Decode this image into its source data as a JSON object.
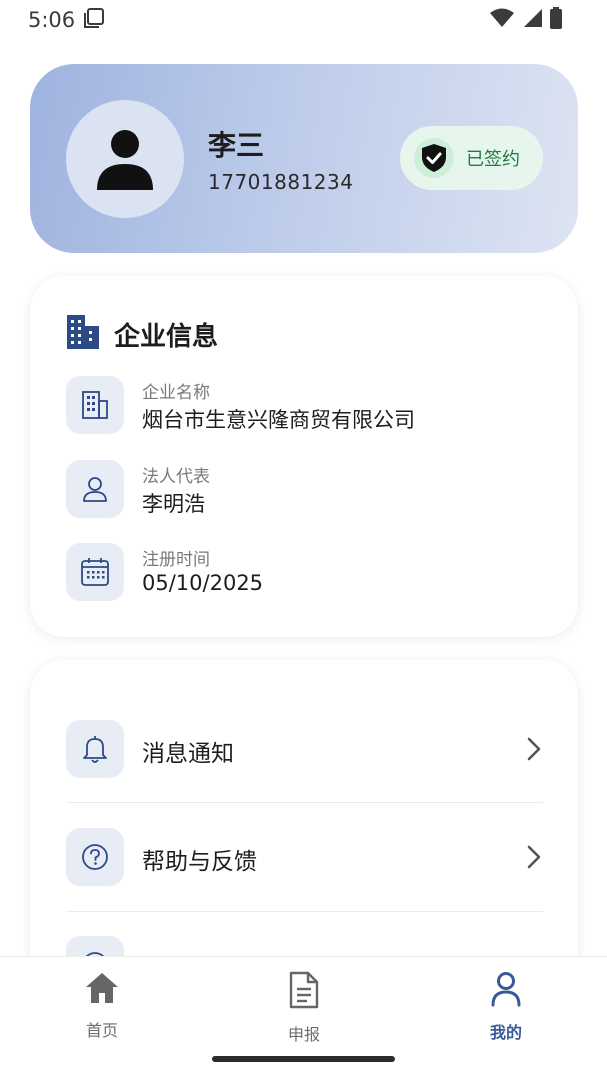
{
  "status_bar": {
    "time": "5:06"
  },
  "profile": {
    "name": "李三",
    "phone": "17701881234",
    "sign_status": "已签约"
  },
  "company": {
    "title": "企业信息",
    "fields": [
      {
        "label": "企业名称",
        "value": "烟台市生意兴隆商贸有限公司",
        "icon": "building-icon"
      },
      {
        "label": "法人代表",
        "value": "李明浩",
        "icon": "person-icon"
      },
      {
        "label": "注册时间",
        "value": "05/10/2025",
        "icon": "calendar-icon"
      }
    ]
  },
  "menu": {
    "items": [
      {
        "label": "消息通知",
        "icon": "bell-icon"
      },
      {
        "label": "帮助与反馈",
        "icon": "help-icon"
      },
      {
        "label": "",
        "icon": "info-icon"
      }
    ]
  },
  "bottom_nav": {
    "items": [
      {
        "label": "首页",
        "icon": "home-icon"
      },
      {
        "label": "申报",
        "icon": "document-icon"
      },
      {
        "label": "我的",
        "icon": "user-icon",
        "active": true
      }
    ]
  },
  "colors": {
    "accent": "#3a5a97",
    "badge_bg": "#e7f6ec",
    "badge_text": "#1f7a44",
    "icon_bg": "#e8edf5"
  }
}
